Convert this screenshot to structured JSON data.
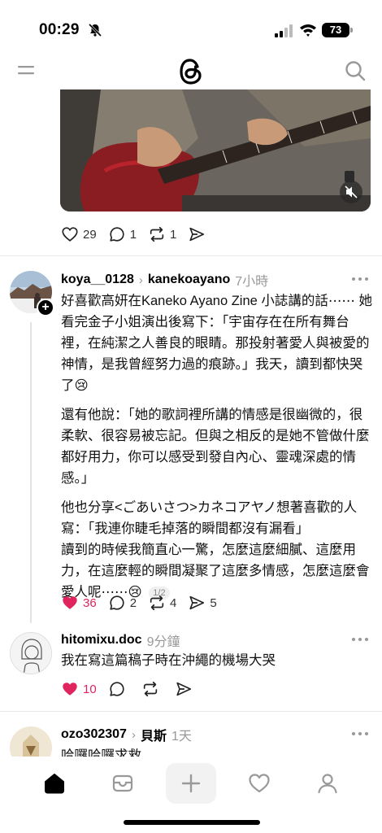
{
  "status_bar": {
    "time": "00:29",
    "battery": "73"
  },
  "video_post": {
    "likes": "29",
    "replies": "1",
    "reposts": "1"
  },
  "post_main": {
    "username": "koya__0128",
    "reply_to": "kanekoayano",
    "time": "7小時",
    "paragraphs": [
      "好喜歡高妍在Kaneko Ayano Zine 小誌講的話⋯⋯ 她看完金子小姐演出後寫下：「宇宙存在在所有舞台裡，在純潔之人善良的眼睛。那投射著愛人與被愛的神情，是我曾經努力過的痕跡。」我天，讀到都快哭了😢",
      "還有他說：「她的歌詞裡所講的情感是很幽微的，很柔軟、很容易被忘記。但與之相反的是她不管做什麼都好用力，你可以感受到發自內心、靈魂深處的情感。」",
      "他也分享<ごあいさつ>カネコアヤノ想著喜歡的人寫：「我連你睫毛掉落的瞬間都沒有漏看」\n讀到的時候我簡直心一驚，怎麼這麼細膩、這麼用力，在這麼輕的瞬間凝聚了這麼多情感，怎麼這麼會愛人呢⋯⋯😢"
    ],
    "page_indicator": "1/2",
    "likes": "36",
    "replies": "2",
    "reposts": "4",
    "shares": "5"
  },
  "post_reply": {
    "username": "hitomixu.doc",
    "time": "9分鐘",
    "text": "我在寫這篇稿子時在沖繩的機場大哭",
    "likes": "10"
  },
  "post_partial": {
    "username": "ozo302307",
    "reply_to": "貝斯",
    "time": "1天",
    "text": "哈囉哈囉求救"
  },
  "colors": {
    "like_red": "#e0245e",
    "text": "#111111",
    "muted": "#999999"
  },
  "icons": [
    "menu-icon",
    "threads-logo",
    "search-icon",
    "heart-icon",
    "comment-icon",
    "repost-icon",
    "share-icon",
    "more-icon",
    "home-icon",
    "inbox-icon",
    "compose-icon",
    "activity-icon",
    "profile-icon"
  ]
}
